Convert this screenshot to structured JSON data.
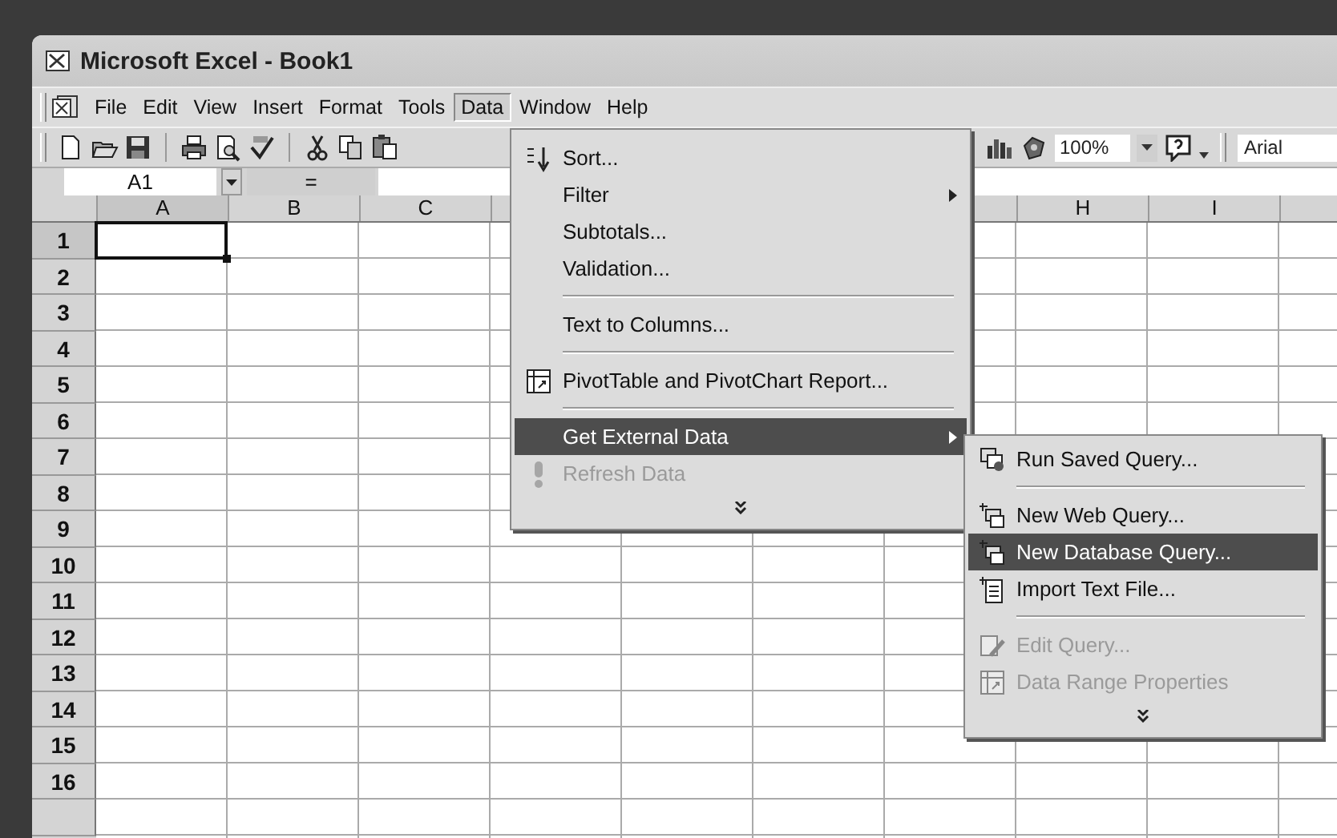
{
  "window": {
    "title": "Microsoft Excel - Book1"
  },
  "menu_bar": [
    {
      "label": "File",
      "selected": false
    },
    {
      "label": "Edit",
      "selected": false
    },
    {
      "label": "View",
      "selected": false
    },
    {
      "label": "Insert",
      "selected": false
    },
    {
      "label": "Format",
      "selected": false
    },
    {
      "label": "Tools",
      "selected": false
    },
    {
      "label": "Data",
      "selected": true
    },
    {
      "label": "Window",
      "selected": false
    },
    {
      "label": "Help",
      "selected": false
    }
  ],
  "toolbar": {
    "zoom": "100%",
    "font": "Arial"
  },
  "formula_bar": {
    "name_box": "A1",
    "equals": "="
  },
  "columns": [
    {
      "label": "A",
      "has_active_cell": true
    },
    {
      "label": "B",
      "has_active_cell": false
    },
    {
      "label": "C",
      "has_active_cell": false
    },
    {
      "label": "H",
      "has_active_cell": false
    },
    {
      "label": "I",
      "has_active_cell": false
    }
  ],
  "rows": [
    {
      "label": "1",
      "has_active_cell": true
    },
    {
      "label": "2",
      "has_active_cell": false
    },
    {
      "label": "3",
      "has_active_cell": false
    },
    {
      "label": "4",
      "has_active_cell": false
    },
    {
      "label": "5",
      "has_active_cell": false
    },
    {
      "label": "6",
      "has_active_cell": false
    },
    {
      "label": "7",
      "has_active_cell": false
    },
    {
      "label": "8",
      "has_active_cell": false
    },
    {
      "label": "9",
      "has_active_cell": false
    },
    {
      "label": "10",
      "has_active_cell": false
    },
    {
      "label": "11",
      "has_active_cell": false
    },
    {
      "label": "12",
      "has_active_cell": false
    },
    {
      "label": "13",
      "has_active_cell": false
    },
    {
      "label": "14",
      "has_active_cell": false
    },
    {
      "label": "15",
      "has_active_cell": false
    },
    {
      "label": "16",
      "has_active_cell": false
    }
  ],
  "data_menu": [
    {
      "kind": "item",
      "label": "Sort...",
      "selected": false,
      "disabled": false,
      "submenu": false
    },
    {
      "kind": "item",
      "label": "Filter",
      "selected": false,
      "disabled": false,
      "submenu": true
    },
    {
      "kind": "item",
      "label": "Subtotals...",
      "selected": false,
      "disabled": false,
      "submenu": false
    },
    {
      "kind": "item",
      "label": "Validation...",
      "selected": false,
      "disabled": false,
      "submenu": false
    },
    {
      "kind": "separator"
    },
    {
      "kind": "item",
      "label": "Text to Columns...",
      "selected": false,
      "disabled": false,
      "submenu": false
    },
    {
      "kind": "separator"
    },
    {
      "kind": "item",
      "label": "PivotTable and PivotChart Report...",
      "selected": false,
      "disabled": false,
      "submenu": false
    },
    {
      "kind": "separator"
    },
    {
      "kind": "item",
      "label": "Get External Data",
      "selected": true,
      "disabled": false,
      "submenu": true
    },
    {
      "kind": "item",
      "label": "Refresh Data",
      "selected": false,
      "disabled": true,
      "submenu": false
    },
    {
      "kind": "more"
    }
  ],
  "external_data_menu": [
    {
      "kind": "item",
      "label": "Run Saved Query...",
      "selected": false,
      "disabled": false,
      "submenu": false
    },
    {
      "kind": "separator"
    },
    {
      "kind": "item",
      "label": "New Web Query...",
      "selected": false,
      "disabled": false,
      "submenu": false
    },
    {
      "kind": "item",
      "label": "New Database Query...",
      "selected": true,
      "disabled": false,
      "submenu": false
    },
    {
      "kind": "item",
      "label": "Import Text File...",
      "selected": false,
      "disabled": false,
      "submenu": false
    },
    {
      "kind": "separator"
    },
    {
      "kind": "item",
      "label": "Edit Query...",
      "selected": false,
      "disabled": true,
      "submenu": false
    },
    {
      "kind": "item",
      "label": "Data Range Properties",
      "selected": false,
      "disabled": true,
      "submenu": false
    },
    {
      "kind": "more"
    }
  ]
}
